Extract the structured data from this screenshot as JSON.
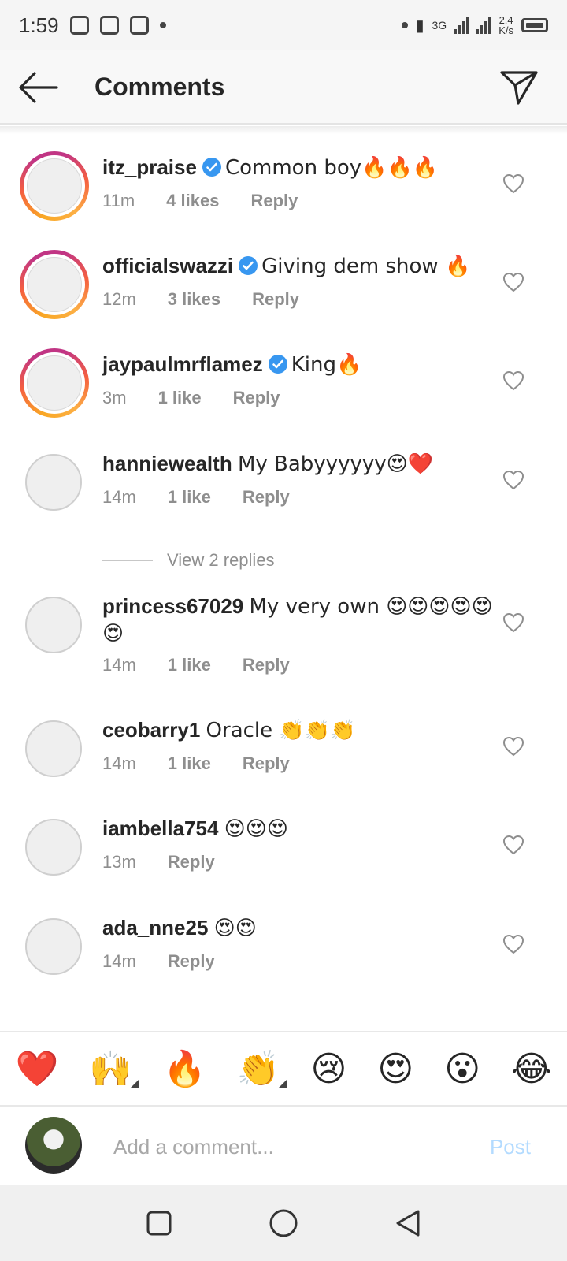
{
  "status_bar": {
    "time": "1:59",
    "network": "3G",
    "speed_value": "2.4",
    "speed_unit": "K/s"
  },
  "header": {
    "title": "Comments",
    "back_icon": "arrow-left-icon",
    "share_icon": "paper-plane-icon"
  },
  "comments": [
    {
      "user": "itz_praise",
      "verified": true,
      "story_ring": true,
      "text": "Common boy🔥🔥🔥",
      "time": "11m",
      "likes": "4 likes",
      "reply": "Reply"
    },
    {
      "user": "officialswazzi",
      "verified": true,
      "story_ring": true,
      "text": "Giving dem show 🔥",
      "time": "12m",
      "likes": "3 likes",
      "reply": "Reply"
    },
    {
      "user": "jaypaulmrflamez",
      "verified": true,
      "story_ring": true,
      "text": "King🔥",
      "time": "3m",
      "likes": "1 like",
      "reply": "Reply"
    },
    {
      "user": "hanniewealth",
      "verified": false,
      "story_ring": false,
      "text": "My Babyyyyyy😍❤️",
      "time": "14m",
      "likes": "1 like",
      "reply": "Reply"
    },
    {
      "user": "princess67029",
      "verified": false,
      "story_ring": false,
      "text": "My very own 😍😍😍😍😍😍",
      "time": "14m",
      "likes": "1 like",
      "reply": "Reply"
    },
    {
      "user": "ceobarry1",
      "verified": false,
      "story_ring": false,
      "text": "Oracle 👏👏👏",
      "time": "14m",
      "likes": "1 like",
      "reply": "Reply"
    },
    {
      "user": "iambella754",
      "verified": false,
      "story_ring": false,
      "text": "😍😍😍",
      "time": "13m",
      "likes": "",
      "reply": "Reply"
    },
    {
      "user": "ada_nne25",
      "verified": false,
      "story_ring": false,
      "text": "😍😍",
      "time": "14m",
      "likes": "",
      "reply": "Reply"
    }
  ],
  "view_replies": "View 2 replies",
  "reactions": [
    "❤️",
    "🙌",
    "🔥",
    "👏",
    "😢",
    "😍",
    "😮",
    "😂"
  ],
  "composer": {
    "placeholder": "Add a comment...",
    "post_label": "Post"
  },
  "colors": {
    "verified_blue": "#3897f0",
    "post_disabled": "#b3dbff",
    "meta_gray": "#8e8e8e"
  }
}
